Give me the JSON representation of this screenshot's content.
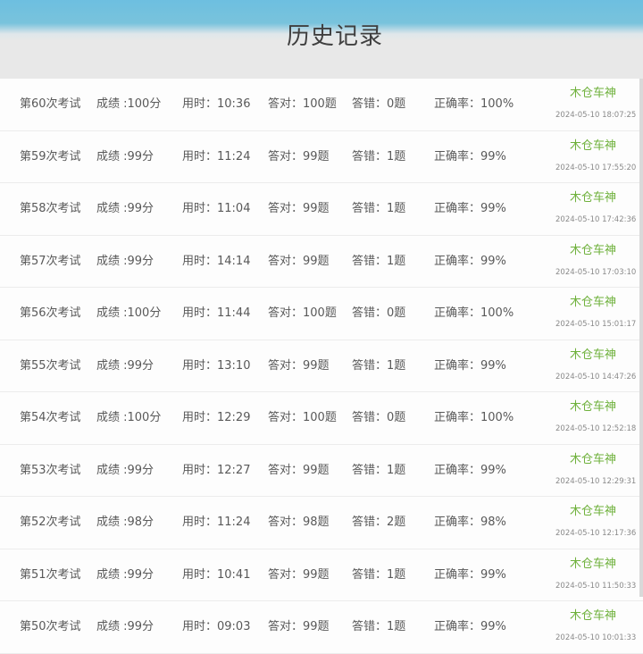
{
  "header": {
    "title": "历史记录"
  },
  "labels": {
    "score": "成绩 :",
    "time": "用时：",
    "correct": "答对：",
    "wrong": "答错：",
    "rate": "正确率："
  },
  "records": [
    {
      "exam": "第60次考试",
      "score": "成绩 :100分",
      "time": "用时：10:36",
      "correct": "答对：100题",
      "wrong": "答错：0题",
      "rate": "正确率：100%",
      "user": "木仓车神",
      "date": "2024-05-10 18:07:25"
    },
    {
      "exam": "第59次考试",
      "score": "成绩 :99分",
      "time": "用时：11:24",
      "correct": "答对：99题",
      "wrong": "答错：1题",
      "rate": "正确率：99%",
      "user": "木仓车神",
      "date": "2024-05-10 17:55:20"
    },
    {
      "exam": "第58次考试",
      "score": "成绩 :99分",
      "time": "用时：11:04",
      "correct": "答对：99题",
      "wrong": "答错：1题",
      "rate": "正确率：99%",
      "user": "木仓车神",
      "date": "2024-05-10 17:42:36"
    },
    {
      "exam": "第57次考试",
      "score": "成绩 :99分",
      "time": "用时：14:14",
      "correct": "答对：99题",
      "wrong": "答错：1题",
      "rate": "正确率：99%",
      "user": "木仓车神",
      "date": "2024-05-10 17:03:10"
    },
    {
      "exam": "第56次考试",
      "score": "成绩 :100分",
      "time": "用时：11:44",
      "correct": "答对：100题",
      "wrong": "答错：0题",
      "rate": "正确率：100%",
      "user": "木仓车神",
      "date": "2024-05-10 15:01:17"
    },
    {
      "exam": "第55次考试",
      "score": "成绩 :99分",
      "time": "用时：13:10",
      "correct": "答对：99题",
      "wrong": "答错：1题",
      "rate": "正确率：99%",
      "user": "木仓车神",
      "date": "2024-05-10 14:47:26"
    },
    {
      "exam": "第54次考试",
      "score": "成绩 :100分",
      "time": "用时：12:29",
      "correct": "答对：100题",
      "wrong": "答错：0题",
      "rate": "正确率：100%",
      "user": "木仓车神",
      "date": "2024-05-10 12:52:18"
    },
    {
      "exam": "第53次考试",
      "score": "成绩 :99分",
      "time": "用时：12:27",
      "correct": "答对：99题",
      "wrong": "答错：1题",
      "rate": "正确率：99%",
      "user": "木仓车神",
      "date": "2024-05-10 12:29:31"
    },
    {
      "exam": "第52次考试",
      "score": "成绩 :98分",
      "time": "用时：11:24",
      "correct": "答对：98题",
      "wrong": "答错：2题",
      "rate": "正确率：98%",
      "user": "木仓车神",
      "date": "2024-05-10 12:17:36"
    },
    {
      "exam": "第51次考试",
      "score": "成绩 :99分",
      "time": "用时：10:41",
      "correct": "答对：99题",
      "wrong": "答错：1题",
      "rate": "正确率：99%",
      "user": "木仓车神",
      "date": "2024-05-10 11:50:33"
    },
    {
      "exam": "第50次考试",
      "score": "成绩 :99分",
      "time": "用时：09:03",
      "correct": "答对：99题",
      "wrong": "答错：1题",
      "rate": "正确率：99%",
      "user": "木仓车神",
      "date": "2024-05-10 10:01:33"
    }
  ],
  "colors": {
    "header_top": "#6dbfe0",
    "header_bottom": "#e8e8e8",
    "user_name": "#6fb13c",
    "text": "#595959",
    "date": "#8a8a8a"
  }
}
